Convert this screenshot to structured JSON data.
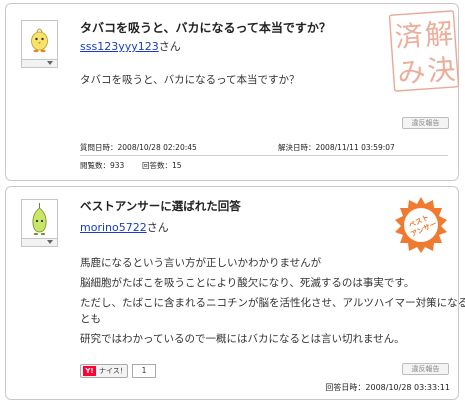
{
  "question": {
    "title": "タバコを吸うと、バカになるって本当ですか？",
    "user_name": "sss123yyy123",
    "user_suffix": "さん",
    "body": "タバコを吸うと、バカになるって本当ですか？",
    "report_label": "違反報告",
    "asked_label": "質問日時：",
    "asked_value": "2008/10/28 02:20:45",
    "resolved_label": "解決日時：",
    "resolved_value": "2008/11/11 03:59:07",
    "views_label": "閲覧数：",
    "views_value": "933",
    "answers_label": "回答数：",
    "answers_value": "15",
    "stamp_text": "解決済み",
    "stamp_color": "#e8a08a"
  },
  "best_answer": {
    "title": "ベストアンサーに選ばれた回答",
    "user_name": "morino5722",
    "user_suffix": "さん",
    "body_lines": [
      "馬鹿になるという言い方が正しいかわかりませんが",
      "脳細胞がたばこを吸うことにより酸欠になり、死滅するのは事実です。",
      "ただし、たばこに含まれるニコチンが脳を活性化させ、アルツハイマー対策になるこ",
      "とも",
      "研究ではわかっているので一概にはバカになるとは言い切れません。"
    ],
    "report_label": "違反報告",
    "nice_logo": "Y!",
    "nice_label": "ナイス！",
    "nice_count": "1",
    "answered_label": "回答日時：",
    "answered_value": "2008/10/28 03:33:11",
    "stamp_text": "ベストアンサー",
    "stamp_color": "#f07a30"
  }
}
